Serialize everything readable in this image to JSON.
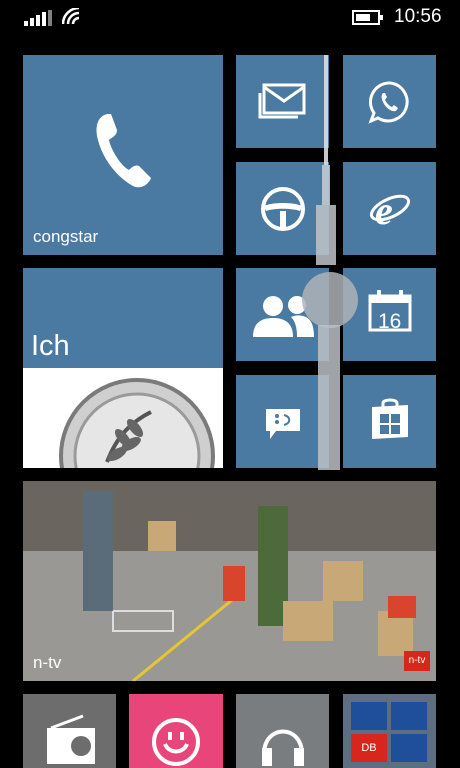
{
  "status_bar": {
    "time": "10:56",
    "signal_icon": "signal-bars-icon",
    "wifi_icon": "wifi-icon",
    "battery_icon": "battery-icon"
  },
  "tiles": {
    "phone": {
      "label": "congstar",
      "icon": "phone-icon"
    },
    "messaging_icon": "envelope-icon",
    "whatsapp_icon": "whatsapp-icon",
    "drive_icon": "steering-wheel-icon",
    "ie_icon": "internet-explorer-icon",
    "me": {
      "label": "Ich"
    },
    "people_icon": "people-icon",
    "calendar": {
      "day": "16",
      "icon": "calendar-icon"
    },
    "messaging2_icon": "chat-smiley-icon",
    "store_icon": "store-bag-icon",
    "news": {
      "label": "n-tv",
      "badge": "n-tv"
    },
    "radio_icon": "radio-icon",
    "music_icon": "smiley-headphones-icon",
    "headphones_icon": "headphones-icon",
    "db": {
      "badge": "DB"
    }
  },
  "colors": {
    "tile_blue": "#4a79a1",
    "pink_tile": "#e8457a",
    "background": "#000000"
  }
}
